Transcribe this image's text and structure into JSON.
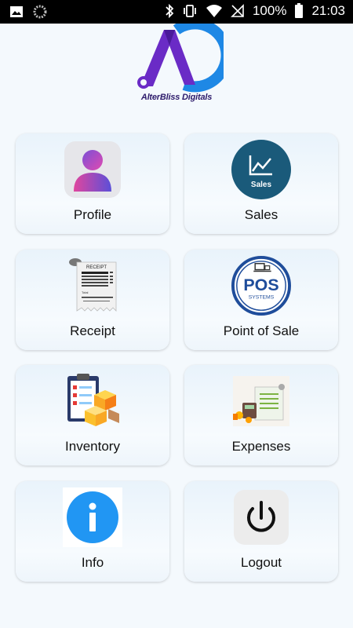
{
  "status_bar": {
    "battery": "100%",
    "time": "21:03",
    "left_icons": [
      "image-icon",
      "sync-icon"
    ],
    "right_icons": [
      "bluetooth-icon",
      "vibrate-icon",
      "wifi-icon",
      "no-sim-icon",
      "battery-icon"
    ]
  },
  "logo": {
    "text": "AlterBliss Digitals",
    "colors": {
      "purple": "#6a2bc6",
      "blue": "#1e88e5"
    }
  },
  "menu": {
    "profile": "Profile",
    "sales": "Sales",
    "sales_icon_text": "Sales",
    "receipt": "Receipt",
    "receipt_icon_text": "RECEIPT",
    "receipt_icon_total": "Total",
    "pos": "Point of Sale",
    "pos_icon_title": "POS",
    "pos_icon_sub": "SYSTEMS",
    "inventory": "Inventory",
    "expenses": "Expenses",
    "info": "Info",
    "logout": "Logout"
  },
  "colors": {
    "background": "#f4f9fd",
    "sales_circle": "#1a5a7a",
    "pos_blue": "#1f4d9b",
    "info_blue": "#2196f3"
  }
}
